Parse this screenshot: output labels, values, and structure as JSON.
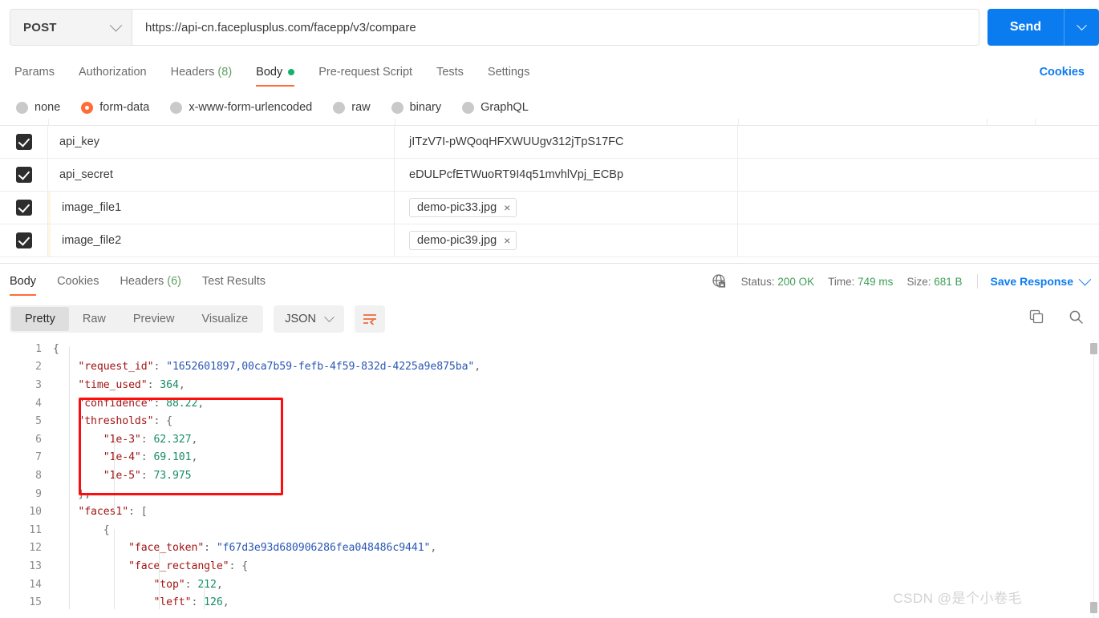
{
  "request": {
    "method": "POST",
    "url": "https://api-cn.faceplusplus.com/facepp/v3/compare",
    "send_label": "Send",
    "tabs": [
      {
        "label": "Params",
        "active": false
      },
      {
        "label": "Authorization",
        "active": false
      },
      {
        "label": "Headers",
        "count": "(8)",
        "active": false
      },
      {
        "label": "Body",
        "active": true,
        "dot": true
      },
      {
        "label": "Pre-request Script",
        "active": false
      },
      {
        "label": "Tests",
        "active": false
      },
      {
        "label": "Settings",
        "active": false
      }
    ],
    "cookies_link": "Cookies",
    "body_modes": [
      {
        "label": "none",
        "selected": false
      },
      {
        "label": "form-data",
        "selected": true
      },
      {
        "label": "x-www-form-urlencoded",
        "selected": false
      },
      {
        "label": "raw",
        "selected": false
      },
      {
        "label": "binary",
        "selected": false
      },
      {
        "label": "GraphQL",
        "selected": false
      }
    ],
    "form_data": [
      {
        "checked": true,
        "key": "api_key",
        "value": "jITzV7I-pWQoqHFXWUUgv312jTpS17FC",
        "type": "text"
      },
      {
        "checked": true,
        "key": "api_secret",
        "value": "eDULPcfETWuoRT9I4q51mvhlVpj_ECBp",
        "type": "text"
      },
      {
        "checked": true,
        "key": "image_file1",
        "value": "demo-pic33.jpg",
        "type": "file"
      },
      {
        "checked": true,
        "key": "image_file2",
        "value": "demo-pic39.jpg",
        "type": "file"
      }
    ],
    "file_remove_label": "×"
  },
  "response": {
    "tabs": [
      {
        "label": "Body",
        "active": true
      },
      {
        "label": "Cookies",
        "active": false
      },
      {
        "label": "Headers",
        "count": "(6)",
        "active": false
      },
      {
        "label": "Test Results",
        "active": false
      }
    ],
    "status_label": "Status:",
    "status_value": "200 OK",
    "time_label": "Time:",
    "time_value": "749 ms",
    "size_label": "Size:",
    "size_value": "681 B",
    "save_response": "Save Response",
    "format_tabs": [
      {
        "label": "Pretty",
        "active": true
      },
      {
        "label": "Raw",
        "active": false
      },
      {
        "label": "Preview",
        "active": false
      },
      {
        "label": "Visualize",
        "active": false
      }
    ],
    "language": "JSON"
  },
  "code_lines": [
    {
      "n": "1",
      "segments": [
        {
          "t": "{",
          "c": "tk-pun"
        }
      ]
    },
    {
      "n": "2",
      "segments": [
        {
          "t": "    ",
          "c": "tk-pun"
        },
        {
          "t": "\"request_id\"",
          "c": "tk-key"
        },
        {
          "t": ": ",
          "c": "tk-pun"
        },
        {
          "t": "\"1652601897,00ca7b59-fefb-4f59-832d-4225a9e875ba\"",
          "c": "tk-str"
        },
        {
          "t": ",",
          "c": "tk-pun"
        }
      ]
    },
    {
      "n": "3",
      "segments": [
        {
          "t": "    ",
          "c": "tk-pun"
        },
        {
          "t": "\"time_used\"",
          "c": "tk-key"
        },
        {
          "t": ": ",
          "c": "tk-pun"
        },
        {
          "t": "364",
          "c": "tk-num"
        },
        {
          "t": ",",
          "c": "tk-pun"
        }
      ]
    },
    {
      "n": "4",
      "segments": [
        {
          "t": "    ",
          "c": "tk-pun"
        },
        {
          "t": "\"confidence\"",
          "c": "tk-key"
        },
        {
          "t": ": ",
          "c": "tk-pun"
        },
        {
          "t": "88.22",
          "c": "tk-num"
        },
        {
          "t": ",",
          "c": "tk-pun"
        }
      ]
    },
    {
      "n": "5",
      "segments": [
        {
          "t": "    ",
          "c": "tk-pun"
        },
        {
          "t": "\"thresholds\"",
          "c": "tk-key"
        },
        {
          "t": ": ",
          "c": "tk-pun"
        },
        {
          "t": "{",
          "c": "tk-pun"
        }
      ]
    },
    {
      "n": "6",
      "segments": [
        {
          "t": "        ",
          "c": "tk-pun"
        },
        {
          "t": "\"1e-3\"",
          "c": "tk-key"
        },
        {
          "t": ": ",
          "c": "tk-pun"
        },
        {
          "t": "62.327",
          "c": "tk-num"
        },
        {
          "t": ",",
          "c": "tk-pun"
        }
      ]
    },
    {
      "n": "7",
      "segments": [
        {
          "t": "        ",
          "c": "tk-pun"
        },
        {
          "t": "\"1e-4\"",
          "c": "tk-key"
        },
        {
          "t": ": ",
          "c": "tk-pun"
        },
        {
          "t": "69.101",
          "c": "tk-num"
        },
        {
          "t": ",",
          "c": "tk-pun"
        }
      ]
    },
    {
      "n": "8",
      "segments": [
        {
          "t": "        ",
          "c": "tk-pun"
        },
        {
          "t": "\"1e-5\"",
          "c": "tk-key"
        },
        {
          "t": ": ",
          "c": "tk-pun"
        },
        {
          "t": "73.975",
          "c": "tk-num"
        }
      ]
    },
    {
      "n": "9",
      "segments": [
        {
          "t": "    ",
          "c": "tk-pun"
        },
        {
          "t": "},",
          "c": "tk-pun"
        }
      ]
    },
    {
      "n": "10",
      "segments": [
        {
          "t": "    ",
          "c": "tk-pun"
        },
        {
          "t": "\"faces1\"",
          "c": "tk-key"
        },
        {
          "t": ": ",
          "c": "tk-pun"
        },
        {
          "t": "[",
          "c": "tk-pun"
        }
      ]
    },
    {
      "n": "11",
      "segments": [
        {
          "t": "        ",
          "c": "tk-pun"
        },
        {
          "t": "{",
          "c": "tk-pun"
        }
      ]
    },
    {
      "n": "12",
      "segments": [
        {
          "t": "            ",
          "c": "tk-pun"
        },
        {
          "t": "\"face_token\"",
          "c": "tk-key"
        },
        {
          "t": ": ",
          "c": "tk-pun"
        },
        {
          "t": "\"f67d3e93d680906286fea048486c9441\"",
          "c": "tk-str"
        },
        {
          "t": ",",
          "c": "tk-pun"
        }
      ]
    },
    {
      "n": "13",
      "segments": [
        {
          "t": "            ",
          "c": "tk-pun"
        },
        {
          "t": "\"face_rectangle\"",
          "c": "tk-key"
        },
        {
          "t": ": ",
          "c": "tk-pun"
        },
        {
          "t": "{",
          "c": "tk-pun"
        }
      ]
    },
    {
      "n": "14",
      "segments": [
        {
          "t": "                ",
          "c": "tk-pun"
        },
        {
          "t": "\"top\"",
          "c": "tk-key"
        },
        {
          "t": ": ",
          "c": "tk-pun"
        },
        {
          "t": "212",
          "c": "tk-num"
        },
        {
          "t": ",",
          "c": "tk-pun"
        }
      ]
    },
    {
      "n": "15",
      "segments": [
        {
          "t": "                ",
          "c": "tk-pun"
        },
        {
          "t": "\"left\"",
          "c": "tk-key"
        },
        {
          "t": ": ",
          "c": "tk-pun"
        },
        {
          "t": "126",
          "c": "tk-num"
        },
        {
          "t": ",",
          "c": "tk-pun"
        }
      ]
    }
  ],
  "watermark": "CSDN @是个小卷毛",
  "colors": {
    "accent": "#ff6c37",
    "link": "#0b7cf0",
    "success": "#3c9e56",
    "annotation": "#fd0d0d"
  }
}
